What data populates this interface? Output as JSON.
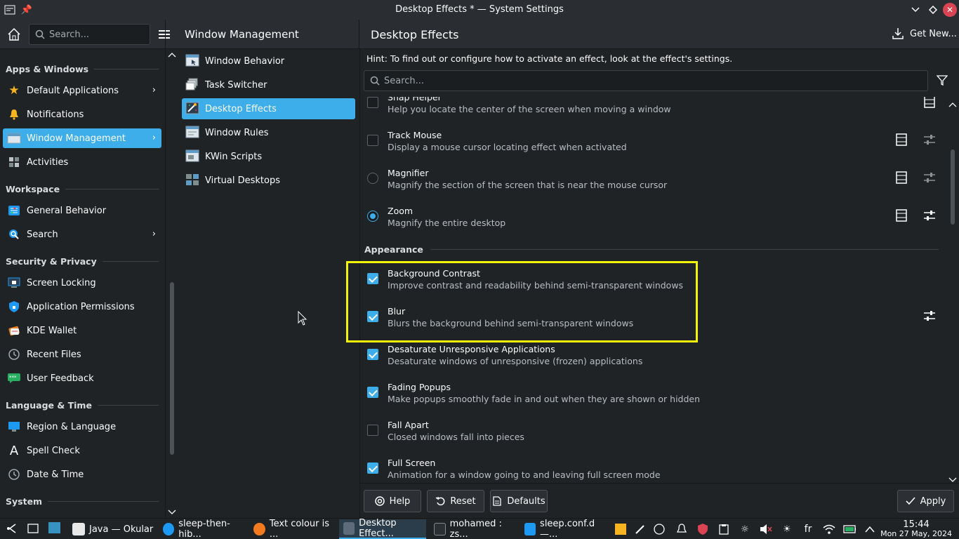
{
  "window": {
    "title": "Desktop Effects * — System Settings"
  },
  "header": {
    "search_placeholder": "Search...",
    "section_title": "Window Management",
    "page_title": "Desktop Effects",
    "get_new_label": "Get New..."
  },
  "sidebar": {
    "categories": {
      "apps": "Apps & Windows",
      "workspace": "Workspace",
      "security": "Security & Privacy",
      "language": "Language & Time",
      "system": "System"
    },
    "items": [
      {
        "label": "Default Applications"
      },
      {
        "label": "Notifications"
      },
      {
        "label": "Window Management"
      },
      {
        "label": "Activities"
      },
      {
        "label": "General Behavior"
      },
      {
        "label": "Search"
      },
      {
        "label": "Screen Locking"
      },
      {
        "label": "Application Permissions"
      },
      {
        "label": "KDE Wallet"
      },
      {
        "label": "Recent Files"
      },
      {
        "label": "User Feedback"
      },
      {
        "label": "Region & Language"
      },
      {
        "label": "Spell Check"
      },
      {
        "label": "Date & Time"
      }
    ]
  },
  "submenu": {
    "items": [
      {
        "label": "Window Behavior"
      },
      {
        "label": "Task Switcher"
      },
      {
        "label": "Desktop Effects"
      },
      {
        "label": "Window Rules"
      },
      {
        "label": "KWin Scripts"
      },
      {
        "label": "Virtual Desktops"
      }
    ]
  },
  "content": {
    "hint": "Hint: To find out or configure how to activate an effect, look at the effect's settings.",
    "search_placeholder": "Search...",
    "appearance_label": "Appearance",
    "effects": [
      {
        "name": "Snap Helper",
        "desc": "Help you locate the center of the screen when moving a window",
        "checked": false
      },
      {
        "name": "Track Mouse",
        "desc": "Display a mouse cursor locating effect when activated",
        "checked": false
      },
      {
        "name": "Magnifier",
        "desc": "Magnify the section of the screen that is near the mouse cursor",
        "checked": false
      },
      {
        "name": "Zoom",
        "desc": "Magnify the entire desktop",
        "checked": true
      },
      {
        "name": "Background Contrast",
        "desc": "Improve contrast and readability behind semi-transparent windows",
        "checked": true
      },
      {
        "name": "Blur",
        "desc": "Blurs the background behind semi-transparent windows",
        "checked": true
      },
      {
        "name": "Desaturate Unresponsive Applications",
        "desc": "Desaturate windows of unresponsive (frozen) applications",
        "checked": true
      },
      {
        "name": "Fading Popups",
        "desc": "Make popups smoothly fade in and out when they are shown or hidden",
        "checked": true
      },
      {
        "name": "Fall Apart",
        "desc": "Closed windows fall into pieces",
        "checked": false
      },
      {
        "name": "Full Screen",
        "desc": "Animation for a window going to and leaving full screen mode",
        "checked": true
      }
    ],
    "buttons": {
      "help": "Help",
      "reset": "Reset",
      "defaults": "Defaults",
      "apply": "Apply"
    }
  },
  "taskbar": {
    "tasks": [
      {
        "label": "Java — Okular"
      },
      {
        "label": "sleep-then-hib..."
      },
      {
        "label": "Text colour is ..."
      },
      {
        "label": "Desktop Effect..."
      },
      {
        "label": "mohamed : zs..."
      },
      {
        "label": "sleep.conf.d —..."
      }
    ],
    "keyboard_layout": "fr",
    "time": "15:44",
    "date": "Mon 27 May, 2024"
  },
  "colors": {
    "accent": "#3daee9",
    "highlight": "#f3f30a",
    "close": "#da4453"
  }
}
